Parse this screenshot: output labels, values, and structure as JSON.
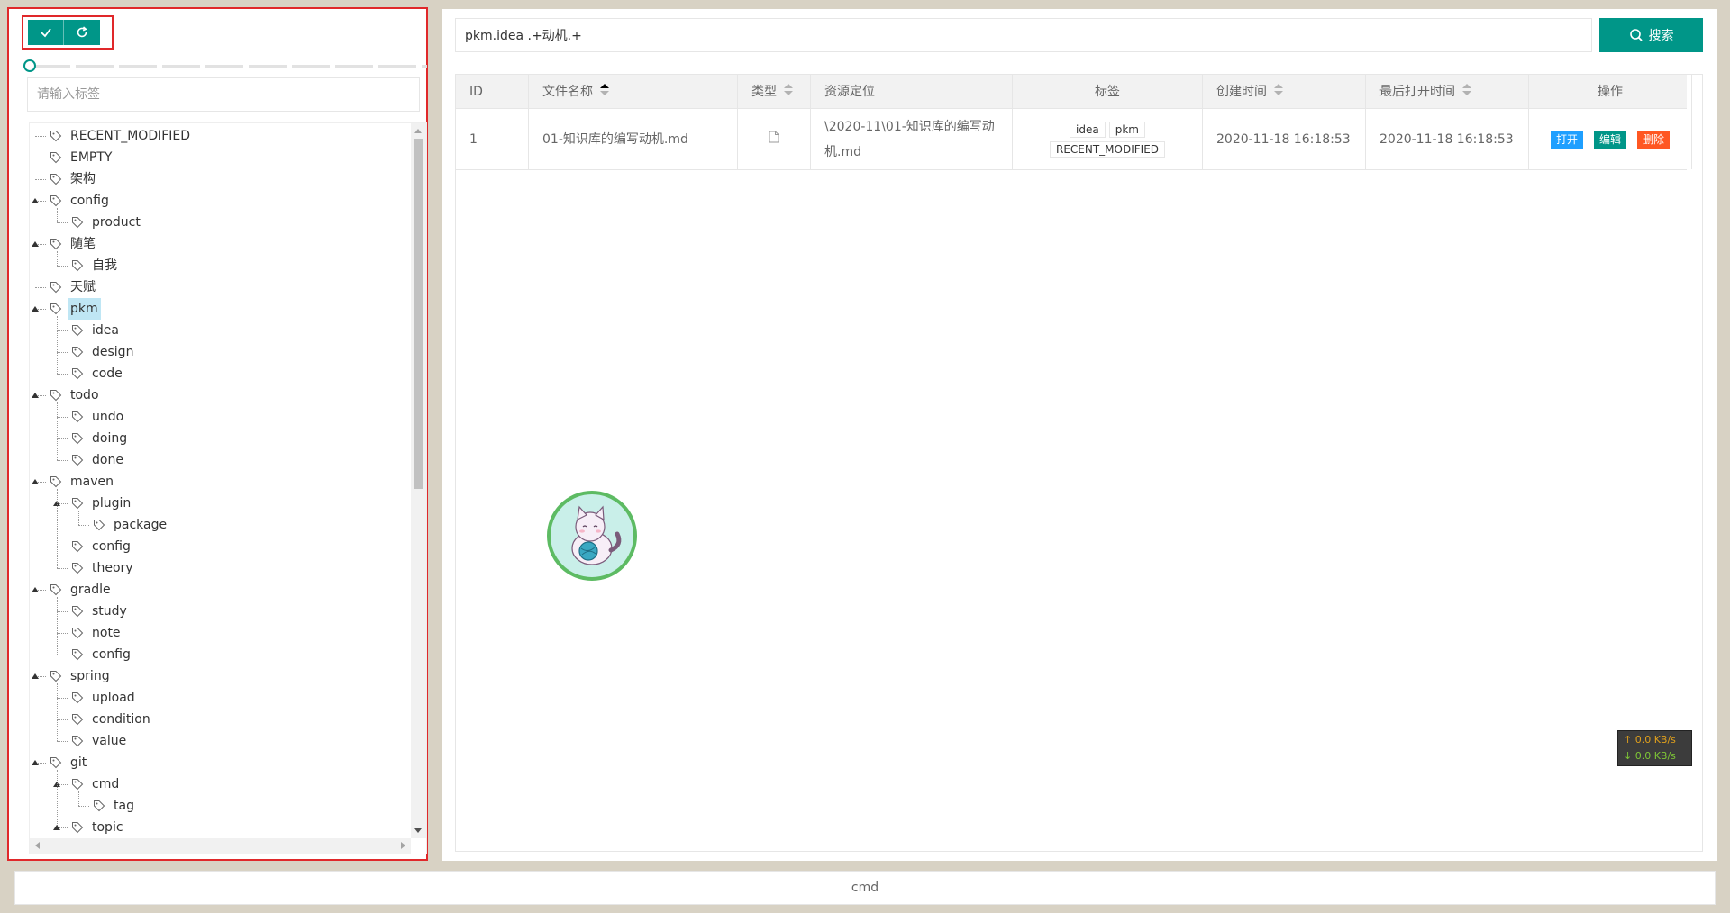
{
  "toolbar": {
    "confirm_icon": "check-icon",
    "refresh_icon": "refresh-icon"
  },
  "tag_filter": {
    "placeholder": "请输入标签",
    "value": ""
  },
  "tree": {
    "items": [
      {
        "label": "RECENT_MODIFIED",
        "depth": 0
      },
      {
        "label": "EMPTY",
        "depth": 0
      },
      {
        "label": "架构",
        "depth": 0
      },
      {
        "label": "config",
        "depth": 0,
        "expanded": true
      },
      {
        "label": "product",
        "depth": 1
      },
      {
        "label": "随笔",
        "depth": 0,
        "expanded": true
      },
      {
        "label": "自我",
        "depth": 1
      },
      {
        "label": "天赋",
        "depth": 0
      },
      {
        "label": "pkm",
        "depth": 0,
        "expanded": true,
        "selected": true
      },
      {
        "label": "idea",
        "depth": 1
      },
      {
        "label": "design",
        "depth": 1
      },
      {
        "label": "code",
        "depth": 1
      },
      {
        "label": "todo",
        "depth": 0,
        "expanded": true
      },
      {
        "label": "undo",
        "depth": 1
      },
      {
        "label": "doing",
        "depth": 1
      },
      {
        "label": "done",
        "depth": 1
      },
      {
        "label": "maven",
        "depth": 0,
        "expanded": true
      },
      {
        "label": "plugin",
        "depth": 1,
        "expanded": true
      },
      {
        "label": "package",
        "depth": 2
      },
      {
        "label": "config",
        "depth": 1
      },
      {
        "label": "theory",
        "depth": 1
      },
      {
        "label": "gradle",
        "depth": 0,
        "expanded": true
      },
      {
        "label": "study",
        "depth": 1
      },
      {
        "label": "note",
        "depth": 1
      },
      {
        "label": "config",
        "depth": 1
      },
      {
        "label": "spring",
        "depth": 0,
        "expanded": true
      },
      {
        "label": "upload",
        "depth": 1
      },
      {
        "label": "condition",
        "depth": 1
      },
      {
        "label": "value",
        "depth": 1
      },
      {
        "label": "git",
        "depth": 0,
        "expanded": true
      },
      {
        "label": "cmd",
        "depth": 1,
        "expanded": true
      },
      {
        "label": "tag",
        "depth": 2
      },
      {
        "label": "topic",
        "depth": 1,
        "expanded": true
      }
    ]
  },
  "search": {
    "value": "pkm.idea .+动机.+",
    "button_label": "搜索"
  },
  "table": {
    "headers": {
      "id": "ID",
      "name": "文件名称",
      "type": "类型",
      "location": "资源定位",
      "tags": "标签",
      "created": "创建时间",
      "opened": "最后打开时间",
      "actions": "操作"
    },
    "rows": [
      {
        "id": "1",
        "name": "01-知识库的编写动机.md",
        "type_icon": "file-icon",
        "location_line1": "\\2020-11\\01-知识库的编写动",
        "location_line2": "机.md",
        "tags": [
          "idea",
          "pkm",
          "RECENT_MODIFIED"
        ],
        "created": "2020-11-18 16:18:53",
        "opened": "2020-11-18 16:18:53",
        "actions": {
          "open": "打开",
          "edit": "编辑",
          "delete": "删除"
        }
      }
    ]
  },
  "colors": {
    "accent": "#009688",
    "open_btn": "#1e9fff",
    "edit_btn": "#009688",
    "delete_btn": "#ff5722",
    "selected_node": "#bfe6f4",
    "highlight_border": "#e0282a"
  },
  "net_monitor": {
    "up": "↑ 0.0 KB/s",
    "down": "↓ 0.0 KB/s"
  },
  "cmd_bar": {
    "label": "cmd"
  }
}
